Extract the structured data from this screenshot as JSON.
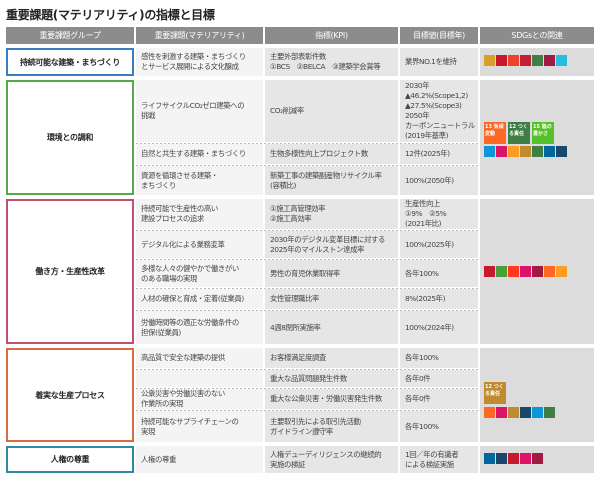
{
  "title": "重要課題(マテリアリティ)の指標と目標",
  "headers": {
    "group": "重要課題グループ",
    "materiality": "重要課題(マテリアリティ)",
    "kpi": "指標(KPI)",
    "target": "目標値(目標年)",
    "sdgs": "SDGsとの関連"
  },
  "groups": [
    {
      "name": "持続可能な建築・まちづくり",
      "color": "#3a7fc1",
      "rows": [
        {
          "materiality": "感性を刺激する建築・まちづくり\nとサービス展開による文化醸成",
          "kpi": "主要外部表彰件数\n①BCS　②BELCA　③建築学会賞等",
          "target": "業界NO.1を維持"
        }
      ]
    },
    {
      "name": "環境との調和",
      "color": "#57a84a",
      "rows": [
        {
          "materiality": "ライフサイクルCO₂ゼロ建築への\n挑戦",
          "kpi": "CO₂削減率",
          "target": "2030年\n▲46.2%(Scope1,2)\n▲27.5%(Scope3)\n2050年\nカーボンニュートラル\n(2019年基準)"
        },
        {
          "materiality": "自然と共生する建築・まちづくり",
          "kpi": "生物多様性向上プロジェクト数",
          "target": "12件(2025年)"
        },
        {
          "materiality": "資源を循環させる建築・\nまちづくり",
          "kpi": "新築工事の建築副産物リサイクル率\n(容積比)",
          "target": "100%(2050年)"
        }
      ]
    },
    {
      "name": "働き方・生産性改革",
      "color": "#c24f6e",
      "rows": [
        {
          "materiality": "持続可能で生産性の高い\n建設プロセスの追求",
          "kpi": "①施工高管理効率\n②施工高効率",
          "target": "生産性向上\n①9%　②5%\n(2021年比)"
        },
        {
          "materiality": "デジタル化による業務変革",
          "kpi": "2030年のデジタル変革目標に対する\n2025年のマイルストン達成率",
          "target": "100%(2025年)"
        },
        {
          "materiality": "多様な人々の健やかで働きがい\nのある職場の実現",
          "kpi": "男性の育児休業取得率",
          "target": "各年100%"
        },
        {
          "materiality": "人材の確保と育成・定着(従業員)",
          "kpi": "女性管理職比率",
          "target": "8%(2025年)"
        },
        {
          "materiality": "労働時間等の適正な労働条件の\n担保(従業員)",
          "kpi": "4週8閉所実施率",
          "target": "100%(2024年)"
        }
      ]
    },
    {
      "name": "着実な生産プロセス",
      "color": "#d76b3f",
      "rows": [
        {
          "materiality": "高品質で安全な建築の提供",
          "kpi": "お客様満足度調査",
          "target": "各年100%"
        },
        {
          "materiality": "",
          "kpi": "重大な品質問題発生件数",
          "target": "各年0件"
        },
        {
          "materiality": "公衆災害や労働災害のない\n作業所の実現",
          "kpi": "重大な公衆災害・労働災害発生件数",
          "target": "各年0件"
        },
        {
          "materiality": "持続可能なサプライチェーンの\n実現",
          "kpi": "主要取引先による取引先活動\nガイドライン遵守率",
          "target": "各年100%"
        }
      ]
    },
    {
      "name": "人権の尊重",
      "color": "#2f8a9f",
      "rows": [
        {
          "materiality": "人権の尊重",
          "kpi": "人権デューディリジェンスの継続的\n実施の検証",
          "target": "1回／年の有識者\nによる検証実施"
        }
      ]
    }
  ],
  "sdg_colors": {
    "g1": [
      "#d9a02c",
      "#c5192d",
      "#ef402b",
      "#c31f33",
      "#3f7e44",
      "#a21942",
      "#26bde2"
    ],
    "g2_big": [
      "#fd6925",
      "#3f7e44",
      "#56c02b"
    ],
    "g2_small": [
      "#0a97d9",
      "#dd1367",
      "#fd9d24",
      "#bf8b2e",
      "#3f7e44",
      "#00689d",
      "#19486a"
    ],
    "g3": [
      "#c5192d",
      "#4c9f38",
      "#ff3a21",
      "#dd1367",
      "#a21942",
      "#fd6925",
      "#fd9d24"
    ],
    "g4": [
      "#fd6925",
      "#dd1367",
      "#bf8b2e",
      "#19486a",
      "#0a97d9",
      "#3f7e44"
    ],
    "g4_big": "#bf8b2e",
    "g5": [
      "#00689d",
      "#19486a",
      "#c5192d",
      "#dd1367",
      "#a21942"
    ]
  },
  "sdg_labels": {
    "g2_big": [
      "13 気候変動",
      "12 つくる責任",
      "15 陸の豊かさ"
    ],
    "g4_big": "12 つくる責任"
  }
}
